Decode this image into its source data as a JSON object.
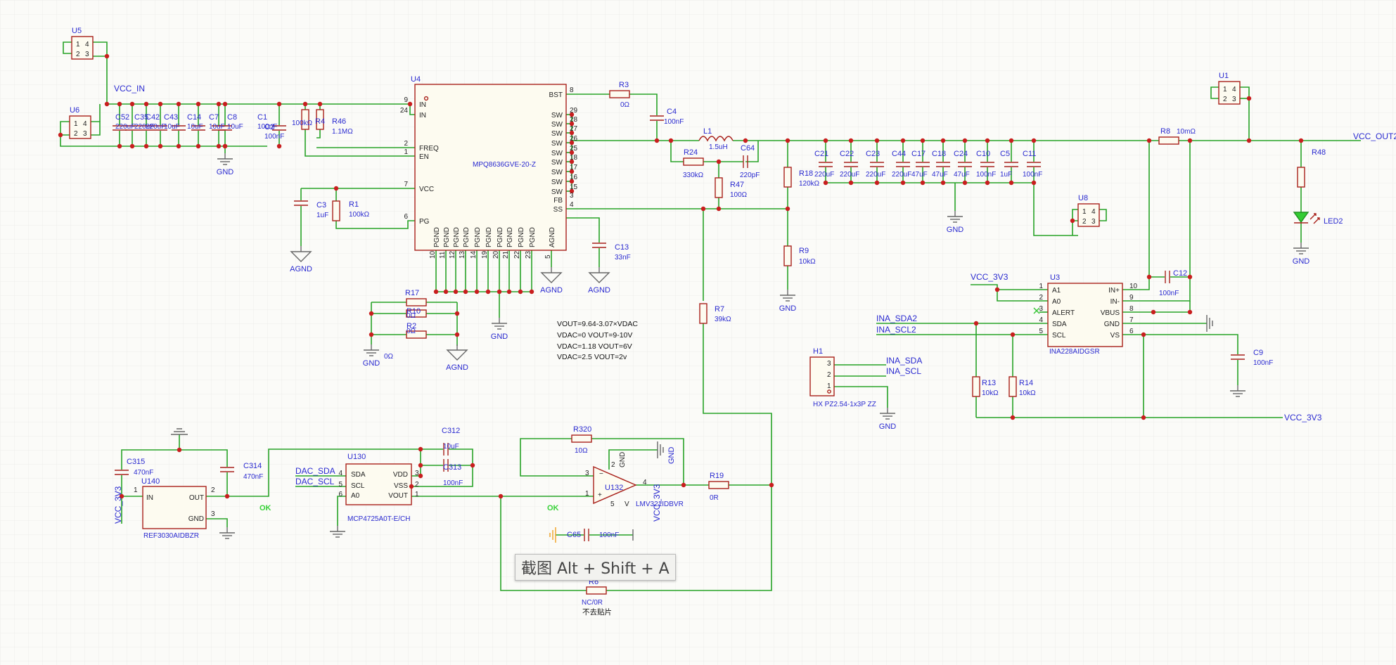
{
  "schematic": {
    "nets": {
      "vcc_in": "VCC_IN",
      "vcc_out2": "VCC_OUT2",
      "vcc_3v3": "VCC_3V3",
      "vcc_3v3_vert": "VCC_3V3",
      "vcc_3v3_bottom": "VCC_3V3",
      "vcc_3v3_u132": "VCC_3V3",
      "ina_sda": "INA_SDA2",
      "ina_scl": "INA_SCL2",
      "h1_sda": "INA_SDA",
      "h1_scl": "INA_SCL",
      "dac_sda": "DAC_SDA",
      "dac_scl": "DAC_SCL",
      "gnd": "GND",
      "agnd": "AGND"
    },
    "parts": {
      "u4": {
        "ref": "U4",
        "value": "MPQ8636GVE-20-Z"
      },
      "u3": {
        "ref": "U3",
        "value": "INA228AIDGSR"
      },
      "u1": {
        "ref": "U1"
      },
      "u5": {
        "ref": "U5"
      },
      "u6": {
        "ref": "U6"
      },
      "u8": {
        "ref": "U8"
      },
      "u130": {
        "ref": "U130",
        "value": "MCP4725A0T-E/CH"
      },
      "u132": {
        "ref": "U132",
        "value": "LMV321IDBVR"
      },
      "u140": {
        "ref": "U140",
        "value": "REF3030AIDBZR"
      },
      "h1": {
        "ref": "H1",
        "value": "HX PZ2.54-1x3P ZZ"
      },
      "l1": {
        "ref": "L1",
        "value": "1.5uH"
      },
      "r3": {
        "ref": "R3",
        "value": "0Ω"
      },
      "r4": {
        "ref": "R4",
        "value": "100kΩ"
      },
      "r46": {
        "ref": "R46",
        "value": "1.1MΩ"
      },
      "r1": {
        "ref": "R1",
        "value": "100kΩ"
      },
      "r24": {
        "ref": "R24",
        "value": "330kΩ"
      },
      "r47": {
        "ref": "R47",
        "value": "100Ω"
      },
      "r18": {
        "ref": "R18",
        "value": "120kΩ"
      },
      "r9": {
        "ref": "R9",
        "value": "10kΩ"
      },
      "r7": {
        "ref": "R7",
        "value": "39kΩ"
      },
      "r8": {
        "ref": "R8",
        "value": "10mΩ"
      },
      "r48": {
        "ref": "R48"
      },
      "r13": {
        "ref": "R13",
        "value": "10kΩ"
      },
      "r14": {
        "ref": "R14",
        "value": "10kΩ"
      },
      "r17": {
        "ref": "R17"
      },
      "r10": {
        "ref": "R10",
        "value": "0Ω"
      },
      "r2": {
        "ref": "R2",
        "value": "0Ω"
      },
      "r2b": {
        "value": "0Ω"
      },
      "r320": {
        "ref": "R320",
        "value": "10Ω"
      },
      "r19": {
        "ref": "R19",
        "value": "0R"
      },
      "r6": {
        "ref": "R6",
        "value": "NC/0R",
        "note": "不去贴片"
      },
      "c4": {
        "ref": "C4",
        "value": "100nF"
      },
      "c64": {
        "ref": "C64",
        "value": "220pF"
      },
      "c3": {
        "ref": "C3",
        "value": "1uF"
      },
      "c13": {
        "ref": "C13",
        "value": "33nF"
      },
      "c12": {
        "ref": "C12",
        "value": "100nF"
      },
      "c9": {
        "ref": "C9",
        "value": "100nF"
      },
      "c312": {
        "ref": "C312",
        "value": "10uF"
      },
      "c313": {
        "ref": "C313",
        "value": "100nF"
      },
      "c315": {
        "ref": "C315",
        "value": "470nF"
      },
      "c314": {
        "ref": "C314",
        "value": "470nF"
      },
      "c65": {
        "ref": "C65",
        "value": "100nF"
      },
      "led2": {
        "ref": "LED2"
      }
    },
    "input_caps": [
      {
        "ref": "C52",
        "value": "220uF"
      },
      {
        "ref": "C35",
        "value": "220uF"
      },
      {
        "ref": "C42",
        "value": "220uF"
      },
      {
        "ref": "C43",
        "value": "10uF"
      },
      {
        "ref": "C14",
        "value": "10uF"
      },
      {
        "ref": "C7",
        "value": "10uF"
      },
      {
        "ref": "C8",
        "value": "10uF"
      },
      {
        "ref": "C1",
        "value": "100nF"
      },
      {
        "ref": "C2",
        "value": "100nF"
      }
    ],
    "output_caps": [
      {
        "ref": "C21",
        "value": "220uF"
      },
      {
        "ref": "C22",
        "value": "220uF"
      },
      {
        "ref": "C23",
        "value": "220uF"
      },
      {
        "ref": "C44",
        "value": "220uF"
      },
      {
        "ref": "C17",
        "value": "47uF"
      },
      {
        "ref": "C18",
        "value": "47uF"
      },
      {
        "ref": "C24",
        "value": "47uF"
      },
      {
        "ref": "C10",
        "value": "100nF"
      },
      {
        "ref": "C5",
        "value": "1uF"
      },
      {
        "ref": "C11",
        "value": "100nF"
      }
    ],
    "u4_pins": {
      "left": [
        {
          "num": "9",
          "name": "IN"
        },
        {
          "num": "24",
          "name": "IN"
        },
        {
          "num": "2",
          "name": "FREQ"
        },
        {
          "num": "1",
          "name": "EN"
        },
        {
          "num": "7",
          "name": "VCC"
        },
        {
          "num": "6",
          "name": "PG"
        }
      ],
      "right": [
        {
          "num": "8",
          "name": "BST"
        },
        {
          "num": "29",
          "name": "SW"
        },
        {
          "num": "28",
          "name": "SW"
        },
        {
          "num": "27",
          "name": "SW"
        },
        {
          "num": "26",
          "name": "SW"
        },
        {
          "num": "25",
          "name": "SW"
        },
        {
          "num": "18",
          "name": "SW"
        },
        {
          "num": "17",
          "name": "SW"
        },
        {
          "num": "16",
          "name": "SW"
        },
        {
          "num": "15",
          "name": "SW"
        },
        {
          "num": "3",
          "name": "FB"
        },
        {
          "num": "4",
          "name": "SS"
        }
      ],
      "bottom": [
        {
          "num": "10",
          "name": "PGND"
        },
        {
          "num": "11",
          "name": "PGND"
        },
        {
          "num": "12",
          "name": "PGND"
        },
        {
          "num": "13",
          "name": "PGND"
        },
        {
          "num": "14",
          "name": "PGND"
        },
        {
          "num": "19",
          "name": "PGND"
        },
        {
          "num": "20",
          "name": "PGND"
        },
        {
          "num": "21",
          "name": "PGND"
        },
        {
          "num": "22",
          "name": "PGND"
        },
        {
          "num": "23",
          "name": "PGND"
        },
        {
          "num": "5",
          "name": "AGND"
        }
      ]
    },
    "u3_pins": {
      "left": [
        {
          "num": "1",
          "name": "A1"
        },
        {
          "num": "2",
          "name": "A0"
        },
        {
          "num": "3",
          "name": "ALERT"
        },
        {
          "num": "4",
          "name": "SDA"
        },
        {
          "num": "5",
          "name": "SCL"
        }
      ],
      "right": [
        {
          "num": "10",
          "name": "IN+"
        },
        {
          "num": "9",
          "name": "IN-"
        },
        {
          "num": "8",
          "name": "VBUS"
        },
        {
          "num": "7",
          "name": "GND"
        },
        {
          "num": "6",
          "name": "VS"
        }
      ]
    },
    "u130_pins": {
      "left": [
        {
          "num": "4",
          "name": "SDA"
        },
        {
          "num": "5",
          "name": "SCL"
        },
        {
          "num": "6",
          "name": "A0"
        }
      ],
      "right": [
        {
          "num": "3",
          "name": "VDD"
        },
        {
          "num": "2",
          "name": "VSS"
        },
        {
          "num": "1",
          "name": "VOUT"
        }
      ]
    },
    "u140_pins": [
      {
        "num": "1",
        "name": "IN"
      },
      {
        "num": "2",
        "name": "OUT"
      },
      {
        "num": "3",
        "name": "GND"
      }
    ],
    "u132_pins": {
      "p1": "1",
      "p2": "2",
      "p3": "3",
      "p4": "4",
      "p5": "5",
      "p2_label": "GND",
      "p5_label": "V"
    },
    "conn_pins": [
      "1",
      "2",
      "3",
      "4"
    ],
    "h1_pins": [
      "3",
      "2",
      "1"
    ],
    "formula": [
      "VOUT=9.64-3.07×VDAC",
      "VDAC=0  VOUT=9-10V",
      "VDAC=1.18  VOUT=6V",
      "VDAC=2.5  VOUT=2v"
    ],
    "ok_marks": [
      "OK",
      "OK"
    ]
  },
  "tooltip": "截图 Alt + Shift + A",
  "colors": {
    "background": "#fbfbf8",
    "wire": "#27a327",
    "part": "#a8201a",
    "junction": "#c81e1e",
    "label": "#2a2ad0",
    "ok": "#39d239"
  }
}
